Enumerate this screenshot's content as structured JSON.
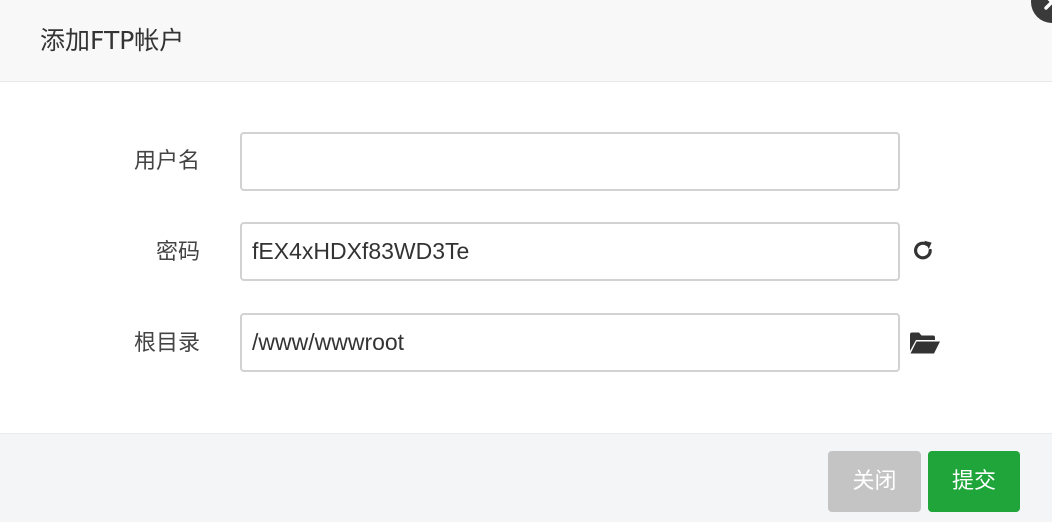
{
  "dialog": {
    "title": "添加FTP帐户"
  },
  "form": {
    "username": {
      "label": "用户名",
      "value": ""
    },
    "password": {
      "label": "密码",
      "value": "fEX4xHDXf83WD3Te"
    },
    "root_dir": {
      "label": "根目录",
      "value": "/www/wwwroot"
    }
  },
  "icons": {
    "close": "close-icon",
    "refresh": "refresh-icon",
    "folder": "folder-open-icon"
  },
  "footer": {
    "close_label": "关闭",
    "submit_label": "提交"
  },
  "colors": {
    "submit": "#20a53a",
    "close_button": "#c4c4c4",
    "header_bg": "#f8f8f8",
    "footer_bg": "#f3f5f6"
  }
}
